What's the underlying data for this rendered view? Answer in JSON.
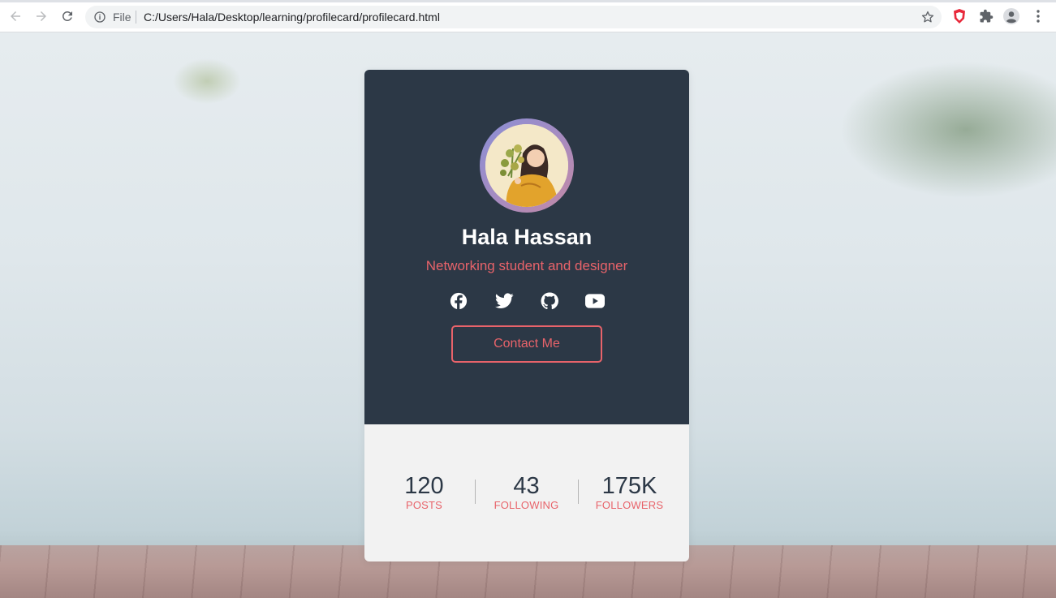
{
  "browser": {
    "back_icon": "arrow-left-icon",
    "forward_icon": "arrow-right-icon",
    "reload_icon": "reload-icon",
    "scheme_label": "File",
    "url": "C:/Users/Hala/Desktop/learning/profilecard/profilecard.html",
    "extensions": [
      "brave-shield-icon",
      "puzzle-icon",
      "profile-icon",
      "more-vertical-icon"
    ]
  },
  "profile": {
    "name": "Hala Hassan",
    "role": "Networking student and designer",
    "socials": [
      "facebook-icon",
      "twitter-icon",
      "github-icon",
      "youtube-icon"
    ],
    "contact_label": "Contact Me"
  },
  "stats": [
    {
      "value": "120",
      "label": "POSTS"
    },
    {
      "value": "43",
      "label": "FOLLOWING"
    },
    {
      "value": "175K",
      "label": "FOLLOWERS"
    }
  ],
  "colors": {
    "card_dark": "#2c3846",
    "accent": "#e8636a",
    "card_light": "#f2f2f2",
    "shield_red": "#e8293b"
  }
}
